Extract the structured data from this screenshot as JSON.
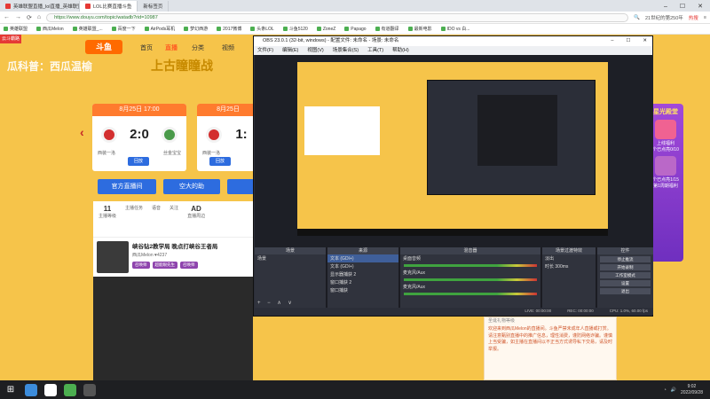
{
  "browser": {
    "tabs": [
      "英雄联盟直播_lol直播_英雄联盟...",
      "LOL比赛直播斗鱼",
      "新标签页"
    ],
    "url": "https://www.douyu.com/topic/watadb?rid=10987",
    "search_hint": "21世纪的第250年",
    "hot_label": "热搜",
    "bookmarks": [
      "英雄联盟",
      "西瓜Melon",
      "英雄联盟_...",
      "百度一下",
      "AirPods耳机",
      "梦幻西游",
      "2017微博",
      "头条LOL",
      "斗鱼5120",
      "ZoneZ",
      "Papago",
      "有道翻译",
      "最新电影",
      "IDO vs 白..."
    ]
  },
  "site": {
    "logo": "斗鱼",
    "nav": [
      "首页",
      "直播",
      "分类",
      "视频"
    ],
    "headline": "瓜科普：西瓜温榆",
    "corner_badge": "云斗霸路",
    "banner_text": "上古瞳瞳战"
  },
  "matches": [
    {
      "time": "8月25日 17:00",
      "score": "2:0",
      "team_left": "西装一洛",
      "team_right": "丝金宝宝",
      "replay": "回放"
    },
    {
      "time": "8月25日",
      "score": "1:",
      "team_left": "西装一洛",
      "team_right": "",
      "replay": "回放"
    }
  ],
  "buttons": {
    "official": "官方直播间",
    "kong": "空大的助"
  },
  "anchor": {
    "stats": [
      {
        "value": "11",
        "label": "主播等级"
      },
      {
        "value": "",
        "label": "主播任务"
      },
      {
        "value": "",
        "label": "语音"
      },
      {
        "value": "",
        "label": "关注"
      },
      {
        "value": "AD",
        "label": "直播周边"
      }
    ],
    "room_title": "峡谷钻2教学局 晚点打峡谷王者局",
    "room_meta": "西瓜Melon ♥4237",
    "tags": [
      "召唤师",
      "超能眼先生",
      "召唤师"
    ]
  },
  "side_ad": {
    "title": "星光殿堂",
    "items": [
      "上线福利",
      "个已点亮0/10",
      "个已点亮1/15",
      "第1周期福利"
    ]
  },
  "chat": {
    "header": "圣诞礼物等级",
    "text": "欢迎来到西瓜Melon的直播间。斗鱼严禁未成年人直播或打赏。请注意甄别直播中的推广信息，理性消费，谨防网络诈骗。谨慎上当受骗，如主播在直播间以不正当方式诱导私下交易，请及时举报。"
  },
  "obs": {
    "title": "OBS 23.0.1 (32-bit, windows) - 配置文件: 未命名 - 场景: 未命名",
    "menu": [
      "文件(F)",
      "编辑(E)",
      "视图(V)",
      "场景集合(S)",
      "工具(T)",
      "帮助(H)"
    ],
    "panels": {
      "scenes": {
        "header": "场景",
        "items": [
          "场景"
        ]
      },
      "sources": {
        "header": "来源",
        "items": [
          "文本 (GDI+)",
          "文本 (GDI+)",
          "显示器捕获 2",
          "窗口捕获 2",
          "窗口捕获"
        ]
      },
      "mixer": {
        "header": "混音器",
        "channels": [
          "桌面音频",
          "麦克风/Aux",
          "麦克风/Aux"
        ]
      },
      "transitions": {
        "header": "场景过渡特效",
        "type": "淡出",
        "duration_label": "时长",
        "duration": "300ms"
      },
      "controls": {
        "header": "控件",
        "buttons": [
          "停止推流",
          "开始录制",
          "工作室模式",
          "设置",
          "退出"
        ]
      }
    },
    "status": [
      "LIVE: 00:00:00",
      "REC: 00:00:00",
      "CPU: 1.0%, 60.00 fps"
    ]
  },
  "taskbar": {
    "time": "9:02",
    "date": "2022/09/28"
  }
}
